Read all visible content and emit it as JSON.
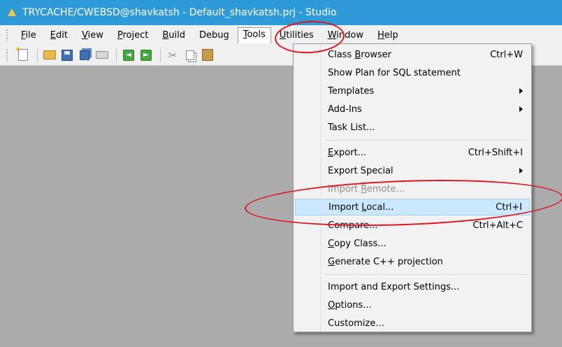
{
  "window": {
    "title": "TRYCACHE/CWEBSD@shavkatsh - Default_shavkatsh.prj - Studio"
  },
  "menubar": {
    "items": [
      {
        "pre": "",
        "key": "F",
        "post": "ile"
      },
      {
        "pre": "",
        "key": "E",
        "post": "dit"
      },
      {
        "pre": "",
        "key": "V",
        "post": "iew"
      },
      {
        "pre": "",
        "key": "P",
        "post": "roject"
      },
      {
        "pre": "",
        "key": "B",
        "post": "uild"
      },
      {
        "pre": "Debu",
        "key": "g",
        "post": ""
      },
      {
        "pre": "",
        "key": "T",
        "post": "ools"
      },
      {
        "pre": "",
        "key": "U",
        "post": "tilities"
      },
      {
        "pre": "",
        "key": "W",
        "post": "indow"
      },
      {
        "pre": "",
        "key": "H",
        "post": "elp"
      }
    ]
  },
  "toolbar": {
    "icons": [
      "new-file-icon",
      "open-folder-icon",
      "save-icon",
      "save-all-icon",
      "print-icon",
      "back-arrow-icon",
      "forward-arrow-icon",
      "cut-icon",
      "copy-icon",
      "paste-icon"
    ]
  },
  "tools_menu": {
    "items": [
      {
        "pre": "Class ",
        "key": "B",
        "post": "rowser",
        "shortcut": "Ctrl+W"
      },
      {
        "pre": "Show Plan for SQL statement",
        "key": "",
        "post": "",
        "shortcut": ""
      },
      {
        "pre": "Templates",
        "key": "",
        "post": "",
        "shortcut": "",
        "submenu": true
      },
      {
        "pre": "Add-Ins",
        "key": "",
        "post": "",
        "shortcut": "",
        "submenu": true
      },
      {
        "pre": "Task List...",
        "key": "",
        "post": "",
        "shortcut": ""
      },
      {
        "pre": "",
        "key": "E",
        "post": "xport...",
        "shortcut": "Ctrl+Shift+I"
      },
      {
        "pre": "Export Special",
        "key": "",
        "post": "",
        "shortcut": "",
        "submenu": true
      },
      {
        "pre": "Import ",
        "key": "R",
        "post": "emote...",
        "shortcut": "",
        "disabled": true
      },
      {
        "pre": "Import ",
        "key": "L",
        "post": "ocal...",
        "shortcut": "Ctrl+I",
        "highlighted": true
      },
      {
        "pre": "Compare...",
        "key": "",
        "post": "",
        "shortcut": "Ctrl+Alt+C"
      },
      {
        "pre": "",
        "key": "C",
        "post": "opy Class...",
        "shortcut": ""
      },
      {
        "pre": "",
        "key": "G",
        "post": "enerate C++ projection",
        "shortcut": ""
      },
      {
        "pre": "Import and Export Settings...",
        "key": "",
        "post": "",
        "shortcut": ""
      },
      {
        "pre": "",
        "key": "O",
        "post": "ptions...",
        "shortcut": ""
      },
      {
        "pre": "Customize...",
        "key": "",
        "post": "",
        "shortcut": ""
      }
    ]
  },
  "colors": {
    "titlebar": "#2f9ad8",
    "highlight": "#cce8ff",
    "annotation": "#e0141c",
    "workspace": "#ababab"
  }
}
